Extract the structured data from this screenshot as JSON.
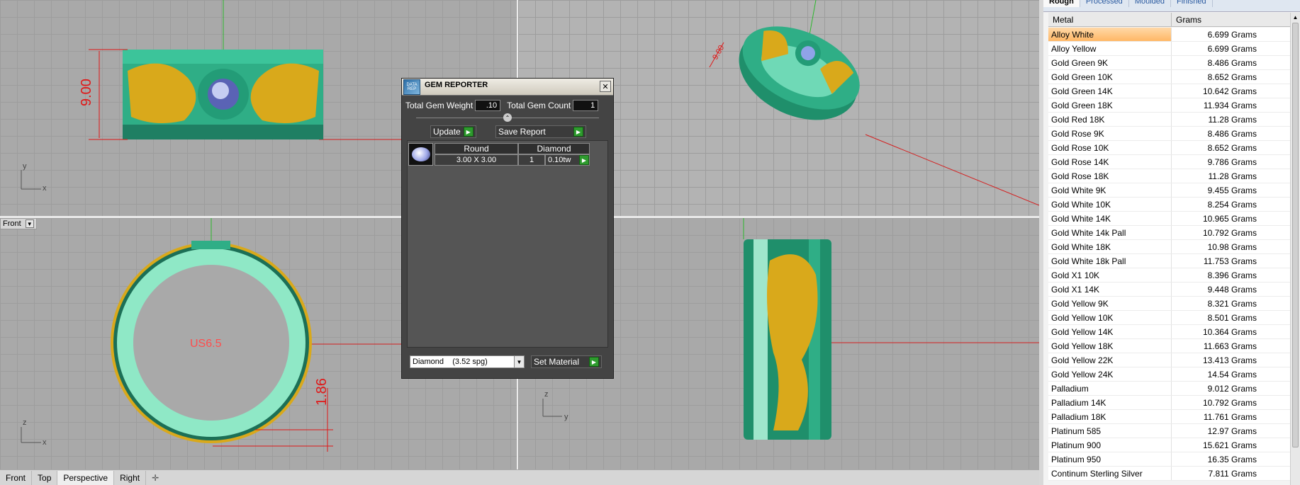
{
  "viewports": {
    "top": {
      "dimension": "9.00",
      "axis_y": "y",
      "axis_x": "x"
    },
    "perspective": {
      "dimension": "9.00"
    },
    "front": {
      "label": "Front",
      "size_text": "US6.5",
      "dimension": "1.86",
      "axis_z": "z",
      "axis_x": "x"
    },
    "right": {
      "axis_z": "z",
      "axis_y": "y"
    }
  },
  "tabs": [
    "Front",
    "Top",
    "Perspective",
    "Right"
  ],
  "active_tab": "Perspective",
  "dialog": {
    "title": "GEM REPORTER",
    "logo_text": "DATA REP",
    "total_weight_label": "Total Gem Weight",
    "total_weight_value": ".10",
    "total_count_label": "Total Gem Count",
    "total_count_value": "1",
    "update_label": "Update",
    "save_label": "Save Report",
    "gem": {
      "shape": "Round",
      "type": "Diamond",
      "size": "3.00 X 3.00",
      "count": "1",
      "weight": "0.10tw"
    },
    "material_value": "Diamond    (3.52 spg)",
    "set_material_label": "Set Material"
  },
  "panel": {
    "tabs": [
      "Rough",
      "Processed",
      "Moulded",
      "Finished"
    ],
    "active_tab": "Rough",
    "columns": [
      "Metal",
      "Grams"
    ],
    "rows": [
      {
        "metal": "Alloy White",
        "grams": "6.699 Grams"
      },
      {
        "metal": "Alloy Yellow",
        "grams": "6.699 Grams"
      },
      {
        "metal": "Gold Green 9K",
        "grams": "8.486 Grams"
      },
      {
        "metal": "Gold Green 10K",
        "grams": "8.652 Grams"
      },
      {
        "metal": "Gold Green 14K",
        "grams": "10.642 Grams"
      },
      {
        "metal": "Gold Green 18K",
        "grams": "11.934 Grams"
      },
      {
        "metal": "Gold Red 18K",
        "grams": "11.28 Grams"
      },
      {
        "metal": "Gold Rose 9K",
        "grams": "8.486 Grams"
      },
      {
        "metal": "Gold Rose 10K",
        "grams": "8.652 Grams"
      },
      {
        "metal": "Gold Rose 14K",
        "grams": "9.786 Grams"
      },
      {
        "metal": "Gold Rose 18K",
        "grams": "11.28 Grams"
      },
      {
        "metal": "Gold White 9K",
        "grams": "9.455 Grams"
      },
      {
        "metal": "Gold White 10K",
        "grams": "8.254 Grams"
      },
      {
        "metal": "Gold White 14K",
        "grams": "10.965 Grams"
      },
      {
        "metal": "Gold White 14k Pall",
        "grams": "10.792 Grams"
      },
      {
        "metal": "Gold White 18K",
        "grams": "10.98 Grams"
      },
      {
        "metal": "Gold White 18k Pall",
        "grams": "11.753 Grams"
      },
      {
        "metal": "Gold X1 10K",
        "grams": "8.396 Grams"
      },
      {
        "metal": "Gold X1 14K",
        "grams": "9.448 Grams"
      },
      {
        "metal": "Gold Yellow 9K",
        "grams": "8.321 Grams"
      },
      {
        "metal": "Gold Yellow 10K",
        "grams": "8.501 Grams"
      },
      {
        "metal": "Gold Yellow 14K",
        "grams": "10.364 Grams"
      },
      {
        "metal": "Gold Yellow 18K",
        "grams": "11.663 Grams"
      },
      {
        "metal": "Gold Yellow 22K",
        "grams": "13.413 Grams"
      },
      {
        "metal": "Gold Yellow 24K",
        "grams": "14.54 Grams"
      },
      {
        "metal": "Palladium",
        "grams": "9.012 Grams"
      },
      {
        "metal": "Palladium 14K",
        "grams": "10.792 Grams"
      },
      {
        "metal": "Palladium 18K",
        "grams": "11.761 Grams"
      },
      {
        "metal": "Platinum 585",
        "grams": "12.97 Grams"
      },
      {
        "metal": "Platinum 900",
        "grams": "15.621 Grams"
      },
      {
        "metal": "Platinum 950",
        "grams": "16.35 Grams"
      },
      {
        "metal": "Continum Sterling Silver",
        "grams": "7.811 Grams"
      }
    ]
  },
  "colors": {
    "ring_green": "#2fae86",
    "ring_gold": "#d9a91b",
    "dimension_red": "#e01818"
  }
}
